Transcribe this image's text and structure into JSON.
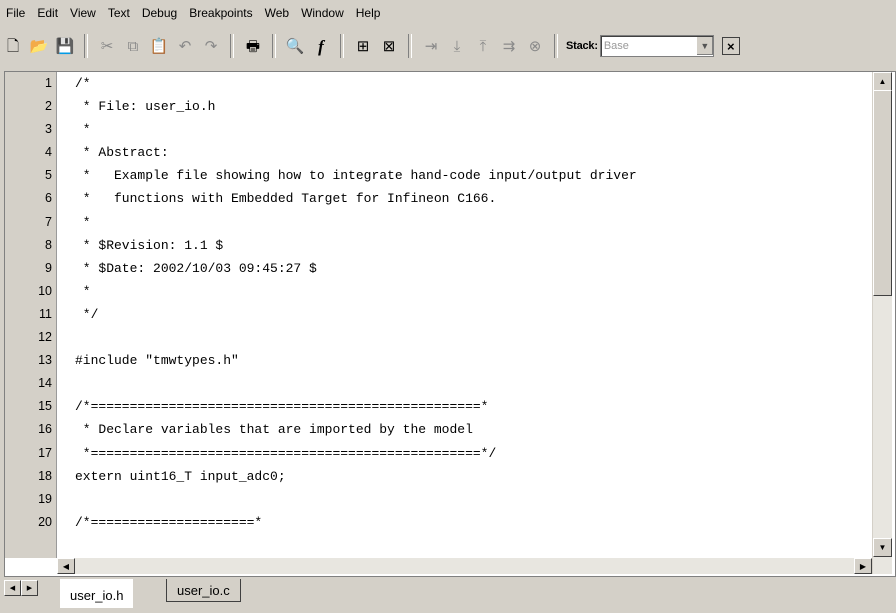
{
  "menu": [
    "File",
    "Edit",
    "View",
    "Text",
    "Debug",
    "Breakpoints",
    "Web",
    "Window",
    "Help"
  ],
  "toolbar": {
    "buttons": [
      {
        "icon": "new-file-icon",
        "glyph": "🗋"
      },
      {
        "icon": "open-folder-icon",
        "glyph": "📂"
      },
      {
        "icon": "save-icon",
        "glyph": "💾"
      },
      {
        "icon": "cut-icon",
        "glyph": "✂"
      },
      {
        "icon": "copy-icon",
        "glyph": "⧉"
      },
      {
        "icon": "paste-icon",
        "glyph": "📋"
      },
      {
        "icon": "undo-icon",
        "glyph": "↶"
      },
      {
        "icon": "redo-icon",
        "glyph": "↷"
      },
      {
        "icon": "print-icon",
        "glyph": "🖶"
      },
      {
        "icon": "find-icon",
        "glyph": "🔍"
      },
      {
        "icon": "function-icon",
        "glyph": "f"
      },
      {
        "icon": "set-breakpoint-icon",
        "glyph": "⊞"
      },
      {
        "icon": "clear-breakpoints-icon",
        "glyph": "⊠"
      },
      {
        "icon": "step-icon",
        "glyph": "⇥"
      },
      {
        "icon": "step-in-icon",
        "glyph": "⤓"
      },
      {
        "icon": "step-out-icon",
        "glyph": "⤒"
      },
      {
        "icon": "continue-icon",
        "glyph": "⇉"
      },
      {
        "icon": "exit-debug-icon",
        "glyph": "⊗"
      }
    ],
    "stack_label": "Stack:",
    "stack_value": "Base"
  },
  "editor": {
    "line_numbers": [
      "1",
      "2",
      "3",
      "4",
      "5",
      "6",
      "7",
      "8",
      "9",
      "10",
      "11",
      "12",
      "13",
      "14",
      "15",
      "16",
      "17",
      "18",
      "19",
      "20"
    ],
    "lines": [
      "/*",
      " * File: user_io.h",
      " *",
      " * Abstract:",
      " *   Example file showing how to integrate hand-code input/output driver",
      " *   functions with Embedded Target for Infineon C166.",
      " *",
      " * $Revision: 1.1 $",
      " * $Date: 2002/10/03 09:45:27 $",
      " *",
      " */",
      "",
      "#include \"tmwtypes.h\"",
      "",
      "/*==================================================*",
      " * Declare variables that are imported by the model",
      " *==================================================*/",
      "extern uint16_T input_adc0;",
      "",
      "/*=====================*"
    ]
  },
  "tabs": [
    {
      "label": "user_io.h",
      "active": true
    },
    {
      "label": "user_io.c",
      "active": false
    }
  ]
}
